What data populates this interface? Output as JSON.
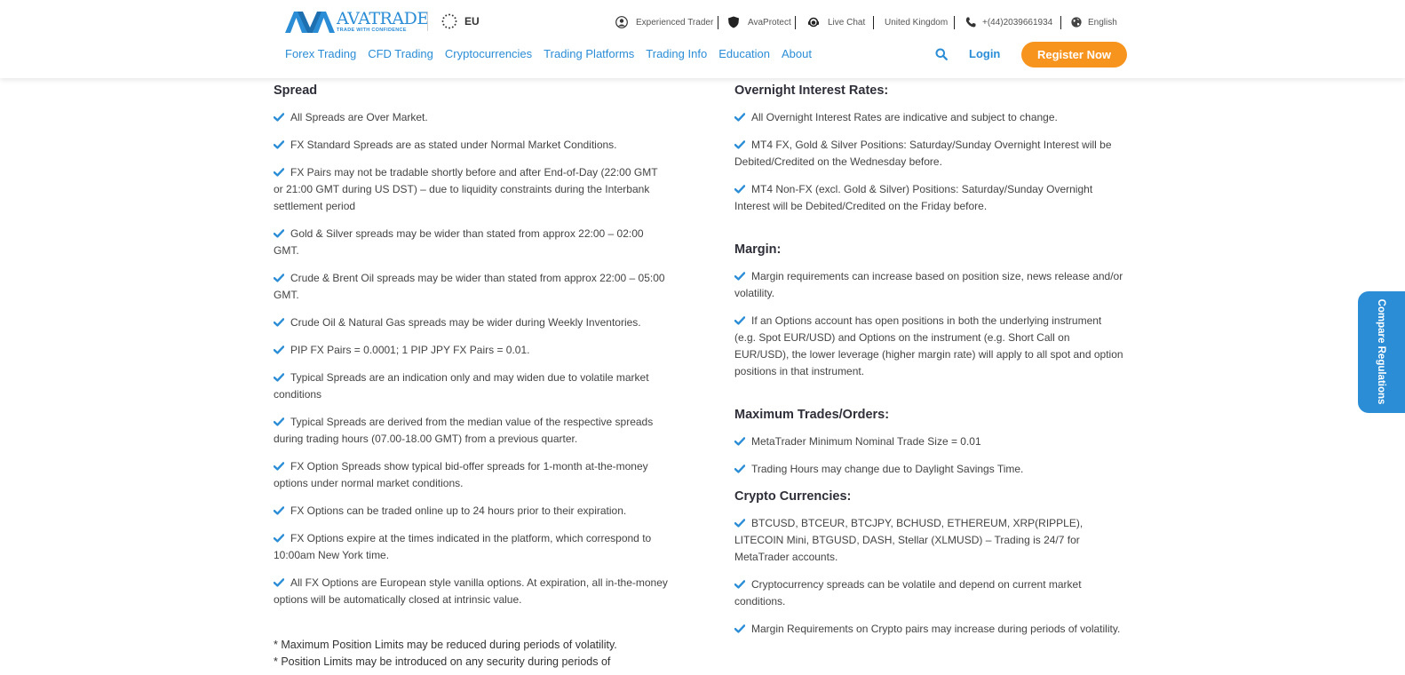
{
  "header": {
    "brand_name": "AVATRADE",
    "brand_tagline": "TRADE WITH CONFIDENCE",
    "region": "EU",
    "topbar": [
      {
        "icon": "user-icon",
        "label": "Experienced Trader"
      },
      {
        "icon": "shield-icon",
        "label": "AvaProtect"
      },
      {
        "icon": "headset-icon",
        "label": "Live Chat"
      },
      {
        "icon": "",
        "label": "United Kingdom"
      },
      {
        "icon": "phone-icon",
        "label": "+(44)2039661934"
      },
      {
        "icon": "globe-icon",
        "label": "English"
      }
    ],
    "nav": [
      "Forex Trading",
      "CFD Trading",
      "Cryptocurrencies",
      "Trading Platforms",
      "Trading Info",
      "Education",
      "About"
    ],
    "login_label": "Login",
    "register_label": "Register Now",
    "colors": {
      "brand": "#2b8dd6",
      "accent": "#f7941d"
    }
  },
  "left": {
    "spread_title": "Spread",
    "spread_items": [
      "All Spreads are Over Market.",
      "FX Standard Spreads are as stated under Normal Market Conditions.",
      "FX Pairs may not be tradable shortly before and after End-of-Day (22:00 GMT or 21:00 GMT during US DST) – due to liquidity constraints during the Interbank settlement period",
      "Gold & Silver spreads may be wider than stated from approx 22:00 – 02:00 GMT.",
      "Crude & Brent Oil spreads may be wider than stated from approx 22:00 – 05:00 GMT.",
      "Crude Oil & Natural Gas spreads may be wider during Weekly Inventories.",
      "PIP FX Pairs = 0.0001; 1 PIP JPY FX Pairs = 0.01.",
      "Typical Spreads are an indication only and may widen due to volatile market conditions",
      "Typical Spreads are derived from the median value of the respective spreads during trading hours (07.00-18.00 GMT) from a previous quarter.",
      "FX Option Spreads show typical bid-offer spreads for 1-month at-the-money options under normal market conditions.",
      "FX Options can be traded online up to 24 hours prior to their expiration.",
      "FX Options expire at the times indicated in the platform, which correspond to 10:00am New York time.",
      "All FX Options are European style vanilla options. At expiration, all in-the-money options will be automatically closed at intrinsic value."
    ],
    "notes": [
      "* Maximum Position Limits may be reduced during periods of volatility.",
      "* Position Limits may be introduced on any security during periods of"
    ]
  },
  "right": {
    "overnight_title": "Overnight Interest Rates:",
    "overnight_items": [
      "All Overnight Interest Rates are indicative and subject to change.",
      "MT4 FX, Gold & Silver Positions: Saturday/Sunday Overnight Interest will be Debited/Credited on the Wednesday before.",
      "MT4 Non-FX (excl. Gold & Silver) Positions: Saturday/Sunday Overnight Interest will be Debited/Credited on the Friday before."
    ],
    "margin_title": "Margin:",
    "margin_items": [
      "Margin requirements can increase based on position size, news release and/or volatility.",
      "If an Options account has open positions in both the underlying instrument (e.g. Spot EUR/USD) and Options on the instrument (e.g. Short Call on EUR/USD), the lower leverage (higher margin rate) will apply to all spot and option positions in that instrument."
    ],
    "max_title": "Maximum Trades/Orders:",
    "max_items": [
      "MetaTrader Minimum Nominal Trade Size = 0.01",
      "Trading Hours may change due to Daylight Savings Time."
    ],
    "crypto_title": "Crypto Currencies:",
    "crypto_items": [
      "BTCUSD, BTCEUR, BTCJPY, BCHUSD, ETHEREUM, XRP(RIPPLE), LITECOIN Mini, BTGUSD, DASH, Stellar (XLMUSD) – Trading is 24/7 for MetaTrader accounts.",
      "Cryptocurrency spreads can be volatile and depend on current market conditions.",
      "Margin Requirements on Crypto pairs may increase during periods of volatility."
    ]
  },
  "side_tab": {
    "label": "Compare Regulations"
  }
}
